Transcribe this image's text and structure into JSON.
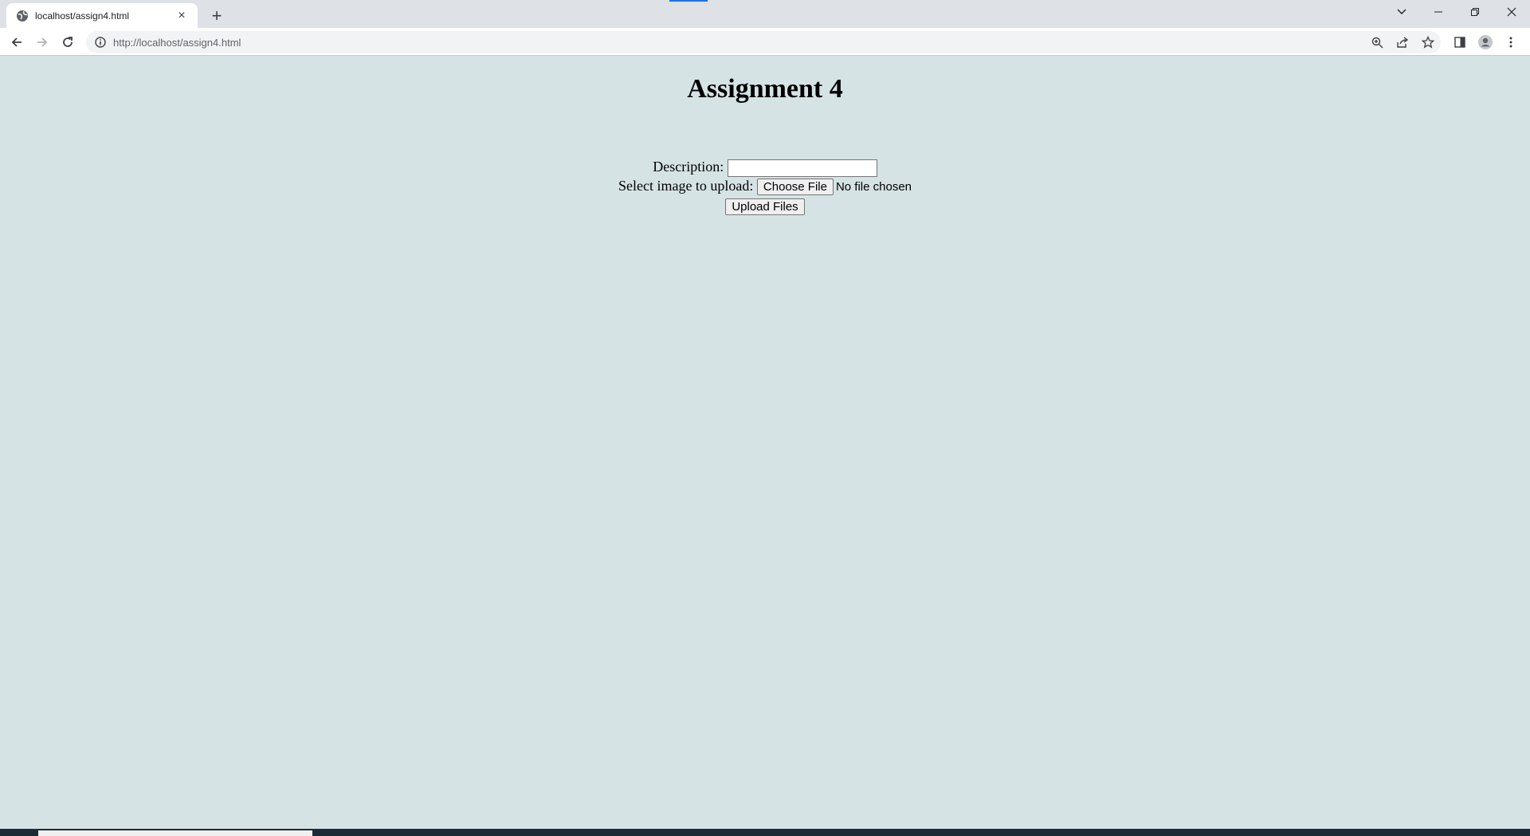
{
  "browser": {
    "tab_title": "localhost/assign4.html",
    "url": "http://localhost/assign4.html",
    "tab_close_glyph": "×",
    "new_tab_glyph": "+",
    "icons": [
      "globe-icon",
      "close-icon",
      "plus-icon",
      "chevron-down-icon",
      "minimize-icon",
      "restore-icon",
      "window-close-icon",
      "back-arrow-icon",
      "forward-arrow-icon",
      "reload-icon",
      "info-icon",
      "zoom-icon",
      "share-icon",
      "star-icon",
      "side-panel-icon",
      "profile-icon",
      "more-menu-icon"
    ]
  },
  "page": {
    "heading": "Assignment 4",
    "description_label": "Description:",
    "description_value": "",
    "select_label": "Select image to upload:",
    "choose_file_label": "Choose File",
    "no_file_text": "No file chosen",
    "upload_button_label": "Upload Files"
  },
  "colors": {
    "page_background": "#d6e3e5",
    "accent": "#1a73e8"
  }
}
